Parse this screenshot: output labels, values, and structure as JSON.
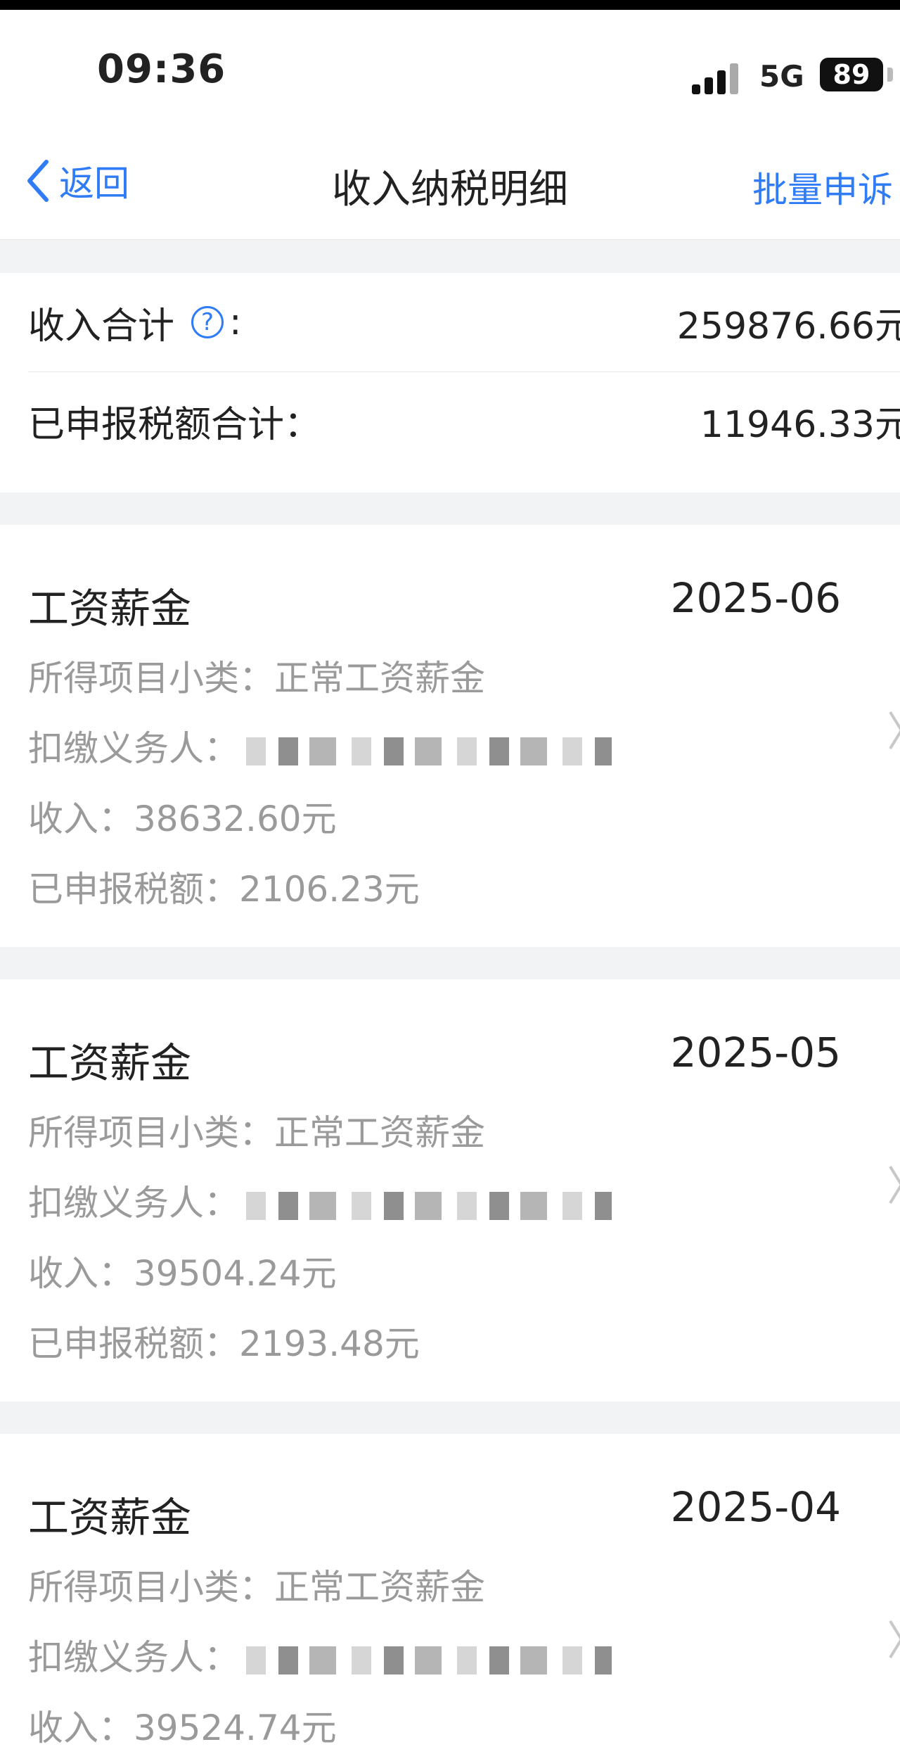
{
  "status_bar": {
    "time": "09:36",
    "network": "5G",
    "battery": "89"
  },
  "nav": {
    "back_label": "返回",
    "title": "收入纳税明细",
    "action_label": "批量申诉"
  },
  "summary": {
    "income_label": "收入合计",
    "income_colon": ":",
    "income_value": "259876.66元",
    "tax_label": "已申报税额合计：",
    "tax_value": "11946.33元",
    "help_glyph": "?"
  },
  "labels": {
    "subcategory": "所得项目小类：",
    "withholder": "扣缴义务人：",
    "income": "收入：",
    "tax": "已申报税额："
  },
  "records": [
    {
      "title": "工资薪金",
      "date": "2025-06",
      "subcategory": "正常工资薪金",
      "income": "38632.60元",
      "tax": "2106.23元"
    },
    {
      "title": "工资薪金",
      "date": "2025-05",
      "subcategory": "正常工资薪金",
      "income": "39504.24元",
      "tax": "2193.48元"
    },
    {
      "title": "工资薪金",
      "date": "2025-04",
      "subcategory": "正常工资薪金",
      "income": "39524.74元"
    }
  ],
  "colors": {
    "accent": "#2f7cf6",
    "muted_text": "#9a9a9a",
    "background": "#f2f3f5"
  }
}
